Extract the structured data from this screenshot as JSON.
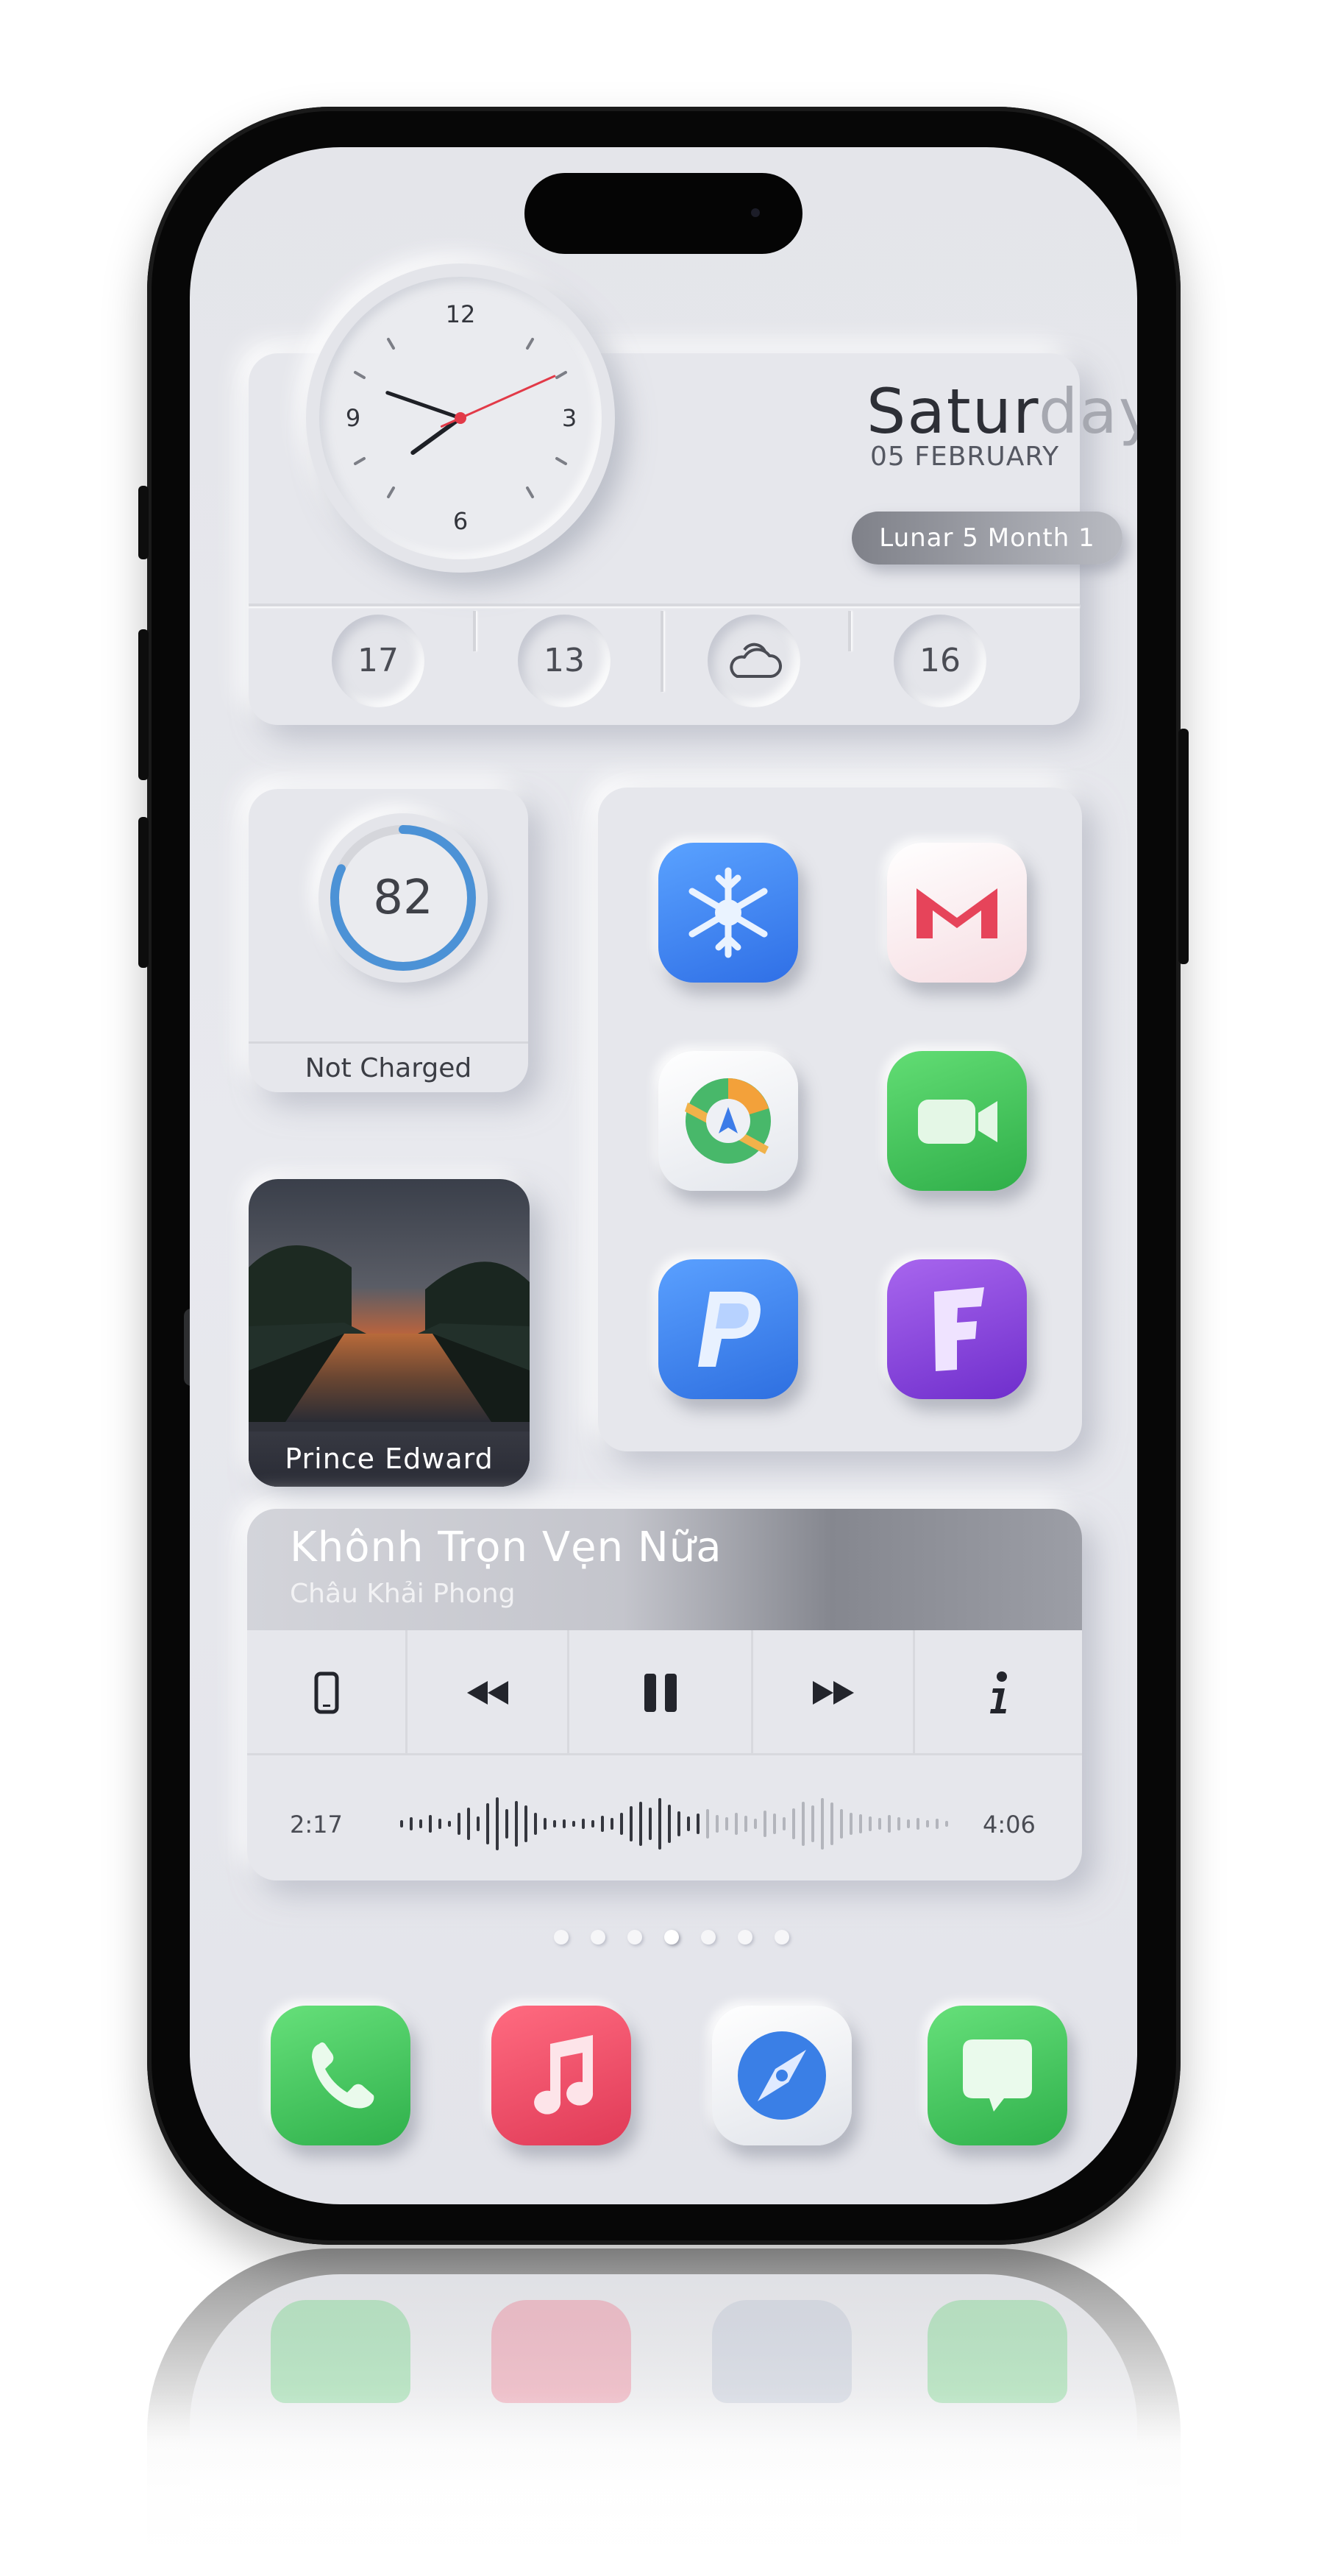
{
  "clock": {
    "numerals": [
      "12",
      "3",
      "6",
      "9"
    ],
    "hour": 7,
    "minute": 48,
    "second": 11
  },
  "date": {
    "day_part1": "Satur",
    "day_part2": "day",
    "date": "05 FEBRUARY",
    "lunar": "Lunar 5 Month 1"
  },
  "weather_stats": [
    "17",
    "13",
    "",
    "16"
  ],
  "battery": {
    "percent": 82,
    "value_text": "82",
    "status": "Not Charged",
    "ring_color": "#4c92d6"
  },
  "photo": {
    "caption": "Prince Edward"
  },
  "apps": [
    {
      "name": "snowflake-app",
      "color": "#3f86f0"
    },
    {
      "name": "gmail-app",
      "color": "#fbe9ec"
    },
    {
      "name": "maps-app",
      "color": "#f1f2f5"
    },
    {
      "name": "facetime-app",
      "color": "#43c45c"
    },
    {
      "name": "paypal-app",
      "color": "#3d82ee"
    },
    {
      "name": "fortnite-app",
      "color": "#8b45d8"
    }
  ],
  "music": {
    "title": "Khônh Trọn Vẹn Nữa",
    "artist": "Châu Khải Phong",
    "elapsed": "2:17",
    "duration": "4:06",
    "progress": 0.56
  },
  "page_indicator": {
    "count": 7,
    "active": 3
  },
  "dock": [
    {
      "name": "phone-app",
      "color": "#3ecb5b"
    },
    {
      "name": "music-app",
      "color": "#f04f6a"
    },
    {
      "name": "safari-app",
      "color": "#f3f4f7"
    },
    {
      "name": "messages-app",
      "color": "#3fcb5b"
    }
  ]
}
